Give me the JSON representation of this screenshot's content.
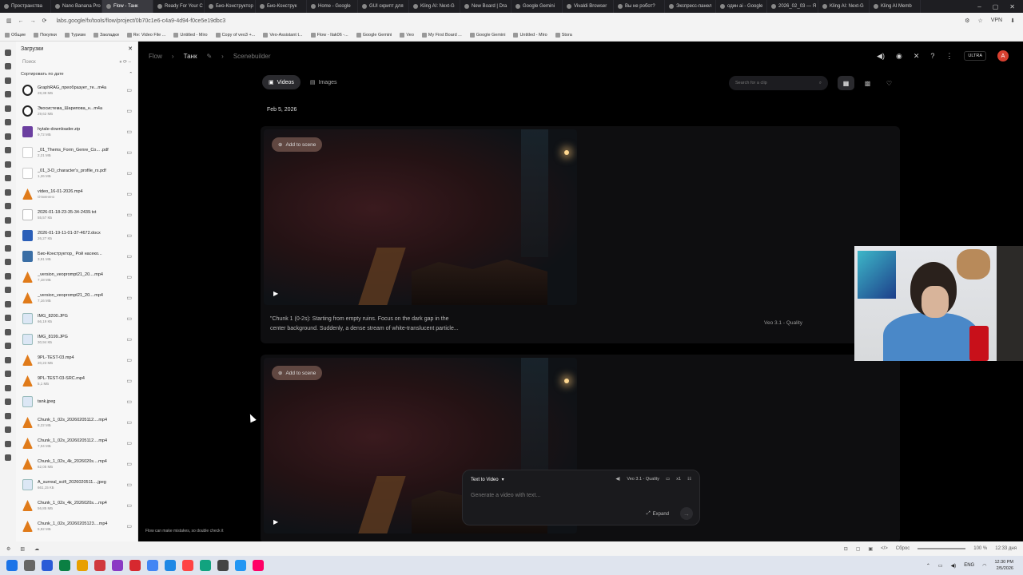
{
  "browser": {
    "tabs": [
      {
        "label": "Пространства",
        "active": false
      },
      {
        "label": "Nano Banana Pro",
        "active": false
      },
      {
        "label": "Flow - Танк",
        "active": true
      },
      {
        "label": "Ready For Your C",
        "active": false
      },
      {
        "label": "Био-Конструктор",
        "active": false
      },
      {
        "label": "Био-Конструк",
        "active": false
      },
      {
        "label": "Home - Google",
        "active": false
      },
      {
        "label": "GUI скрипт для",
        "active": false
      },
      {
        "label": "Kling AI: Next-G",
        "active": false
      },
      {
        "label": "New Board | Dra",
        "active": false
      },
      {
        "label": "Google Gemini",
        "active": false
      },
      {
        "label": "Vivaldi Browser",
        "active": false
      },
      {
        "label": "Вы не робот?",
        "active": false
      },
      {
        "label": "Экспресс-панел",
        "active": false
      },
      {
        "label": "один ai - Google",
        "active": false
      },
      {
        "label": "2026_02_03 — Я",
        "active": false
      },
      {
        "label": "Kling AI: Next-G",
        "active": false
      },
      {
        "label": "Kling AI Memb",
        "active": false
      }
    ],
    "url": "labs.google/fx/tools/flow/project/0b70c1e6-c4a9-4d94-f0ce5e19dbc3",
    "bookmarks": [
      "Общие",
      "Покупки",
      "Туризм",
      "Закладки",
      "Re: Video File ...",
      "Untitled - Miro",
      "Copy of veo3 +...",
      "Veo-Assistant t...",
      "Flow - Ilak06 -...",
      "Google Gemini",
      "Veo",
      "My First Board ...",
      "Google Gemini",
      "Untitled - Miro",
      "Stora"
    ]
  },
  "downloads": {
    "title": "Загрузки",
    "search_placeholder": "Поиск",
    "sort_label": "Сортировать по дате",
    "items": [
      {
        "name": "GraphRAG_преобразует_те...m4a",
        "size": "28,38 МБ",
        "type": "rec"
      },
      {
        "name": "Экосистема_Шарипова_н...m4a",
        "size": "29,62 МБ",
        "type": "rec"
      },
      {
        "name": "hytale-downloader.zip",
        "size": "9,72 МБ",
        "type": "zip"
      },
      {
        "name": "_01_Thems_Form_Genre_Co... .pdf",
        "size": "2,21 МБ",
        "type": "pdf"
      },
      {
        "name": "_01_3-D_character's_profile_rs.pdf",
        "size": "1,26 МБ",
        "type": "pdf"
      },
      {
        "name": "video_16-01-2026.mp4",
        "size": "Отменено",
        "type": "video"
      },
      {
        "name": "2026-01-18-23-35-34-2439.txt",
        "size": "55,57 КБ",
        "type": "txt"
      },
      {
        "name": "2026-01-19-11-01-37-4672.docx",
        "size": "26,27 КБ",
        "type": "docx"
      },
      {
        "name": "Био-Конструктор_ Рой насеко...",
        "size": "3,91 МБ",
        "type": "exe"
      },
      {
        "name": "_version_veoprompt21_20....mp4",
        "size": "7,18 МБ",
        "type": "video"
      },
      {
        "name": "_version_veoprompt21_20....mp4",
        "size": "7,16 МБ",
        "type": "video"
      },
      {
        "name": "IMG_8200.JPG",
        "size": "66,19 КБ",
        "type": "img"
      },
      {
        "name": "IMG_8199.JPG",
        "size": "30,94 КБ",
        "type": "img"
      },
      {
        "name": "9PL-TEST-03.mp4",
        "size": "20,23 МБ",
        "type": "video"
      },
      {
        "name": "9PL-TEST-03-SRC.mp4",
        "size": "5,1 МБ",
        "type": "video"
      },
      {
        "name": "tank.jpeg",
        "size": "",
        "type": "img"
      },
      {
        "name": "Chunk_1_02s_20260205112....mp4",
        "size": "8,22 МБ",
        "type": "video"
      },
      {
        "name": "Chunk_1_02s_20260205112....mp4",
        "size": "7,04 МБ",
        "type": "video"
      },
      {
        "name": "Chunk_1_02s_4k_2026020s....mp4",
        "size": "62,05 МБ",
        "type": "video"
      },
      {
        "name": "A_surreal_scifi_2026020511....jpeg",
        "size": "661,15 КБ",
        "type": "img"
      },
      {
        "name": "Chunk_1_02s_4k_2026020s....mp4",
        "size": "56,85 МБ",
        "type": "video"
      },
      {
        "name": "Chunk_1_02s_20260205123....mp4",
        "size": "5,92 МБ",
        "type": "video"
      }
    ]
  },
  "flow": {
    "breadcrumb": {
      "root": "Flow",
      "project": "Танк",
      "page": "Scenebuilder"
    },
    "plan_badge": "ULTRA",
    "avatar_letter": "A",
    "tabs": [
      {
        "label": "Videos",
        "active": true
      },
      {
        "label": "Images",
        "active": false
      }
    ],
    "search_placeholder": "Search for a clip",
    "date_label": "Feb 5, 2026",
    "cards": [
      {
        "add_label": "Add to scene",
        "caption_line1": "\"Chunk 1 (0-2s): Starting from empty ruins. Focus on the dark gap in the",
        "caption_line2": "center background. Suddenly, a dense stream of white-translucent particle...",
        "model": "Veo 3.1 - Quality"
      },
      {
        "add_label": "Add to scene",
        "caption_line1": "",
        "caption_line2": "",
        "model": ""
      }
    ],
    "composer": {
      "mode": "Text to Video",
      "model": "Veo 3.1 - Quality",
      "count": "x1",
      "placeholder": "Generate a video with text...",
      "expand_label": "Expand"
    },
    "disclaimer": "Flow can make mistakes, so double check it"
  },
  "statusbar": {
    "reset_label": "Сброс",
    "zoom": "100 %",
    "time": "12:33 дня"
  },
  "taskbar": {
    "lang": "ENG",
    "time": "12:30 PM",
    "date": "2/5/2026"
  }
}
